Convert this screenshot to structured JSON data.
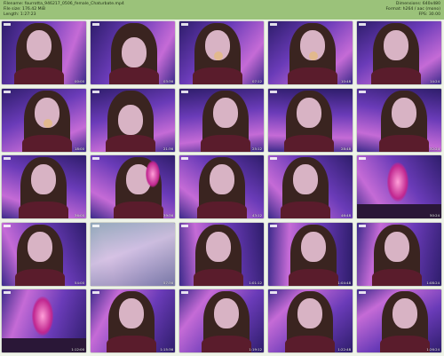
{
  "info": {
    "filename": "Filename: fourrotta_946217_0506_female_Chaturbate.mp4",
    "filesize": "File size: 176.42 MiB",
    "length": "Length: 1:27:23",
    "dimensions": "Dimensions: 640x480",
    "format": "Format: h264 / aac (mono)",
    "fps": "FPS: 30.00"
  },
  "colors": {
    "header_bg": "#9bc27a",
    "page_bg": "#eef3e8"
  },
  "thumbnails": [
    {
      "time": "00:00",
      "scene": "face"
    },
    {
      "time": "03:36",
      "scene": "face-down"
    },
    {
      "time": "07:12",
      "scene": "eating"
    },
    {
      "time": "10:48",
      "scene": "hand-lip"
    },
    {
      "time": "14:24",
      "scene": "face"
    },
    {
      "time": "18:00",
      "scene": "eating"
    },
    {
      "time": "21:36",
      "scene": "face-down"
    },
    {
      "time": "25:12",
      "scene": "face"
    },
    {
      "time": "28:48",
      "scene": "face"
    },
    {
      "time": "32:24",
      "scene": "face"
    },
    {
      "time": "36:00",
      "scene": "face"
    },
    {
      "time": "39:36",
      "scene": "side"
    },
    {
      "time": "43:12",
      "scene": "face"
    },
    {
      "time": "46:48",
      "scene": "face"
    },
    {
      "time": "50:24",
      "scene": "lamp"
    },
    {
      "time": "54:00",
      "scene": "face"
    },
    {
      "time": "57:36",
      "scene": "blur"
    },
    {
      "time": "1:01:12",
      "scene": "face"
    },
    {
      "time": "1:04:48",
      "scene": "face"
    },
    {
      "time": "1:08:24",
      "scene": "face"
    },
    {
      "time": "1:12:00",
      "scene": "lamp"
    },
    {
      "time": "1:15:36",
      "scene": "face"
    },
    {
      "time": "1:19:12",
      "scene": "face"
    },
    {
      "time": "1:22:48",
      "scene": "face"
    },
    {
      "time": "1:26:24",
      "scene": "face"
    }
  ]
}
